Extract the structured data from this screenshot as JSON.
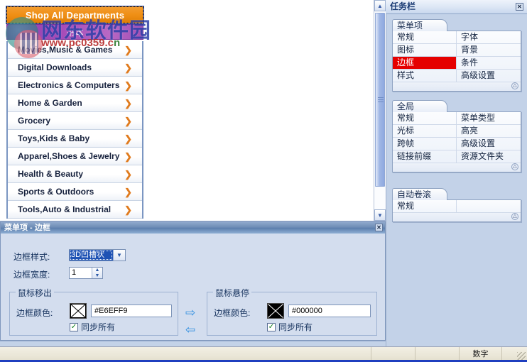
{
  "canvas": {
    "menu_widget": {
      "top_item_label": "Shop All Departments",
      "sub_item_label": "书本",
      "items": [
        {
          "label": "Movies,Music & Games",
          "chevron": "❯"
        },
        {
          "label": "Digital Downloads",
          "chevron": "❯"
        },
        {
          "label": "Electronics & Computers",
          "chevron": "❯"
        },
        {
          "label": "Home & Garden",
          "chevron": "❯"
        },
        {
          "label": "Grocery",
          "chevron": "❯"
        },
        {
          "label": "Toys,Kids & Baby",
          "chevron": "❯"
        },
        {
          "label": "Apparel,Shoes & Jewelry",
          "chevron": "❯"
        },
        {
          "label": "Health & Beauty",
          "chevron": "❯"
        },
        {
          "label": "Sports & Outdoors",
          "chevron": "❯"
        },
        {
          "label": "Tools,Auto & Industrial",
          "chevron": "❯"
        }
      ]
    },
    "watermark": {
      "chinese": "网东软件园",
      "url_red": "www.pc0359.c",
      "url_green": "n"
    },
    "scrollbar": {
      "up_arrow": "▲",
      "down_arrow": "▼"
    }
  },
  "property_dialog": {
    "title": "菜单项 - 边框",
    "close_label": "✕",
    "border_style": {
      "label": "边框样式:",
      "value": "3D凹槽状",
      "arrow": "▼"
    },
    "border_width": {
      "label": "边框宽度:",
      "value": "1",
      "up": "▲",
      "down": "▼"
    },
    "mouse_out": {
      "legend": "鼠标移出",
      "color_label": "边框颜色:",
      "color_value": "#E6EFF9",
      "sync_label": "同步所有",
      "sync_checked": "✓"
    },
    "mouse_over": {
      "legend": "鼠标悬停",
      "color_label": "边框颜色:",
      "color_value": "#000000",
      "sync_label": "同步所有",
      "sync_checked": "✓"
    },
    "copy_right_arrow": "⇨",
    "copy_left_arrow": "⇦"
  },
  "task_panel": {
    "title": "任务栏",
    "close_label": "✕",
    "groups": [
      {
        "tab": "菜单项",
        "rows": [
          [
            "常规",
            "字体"
          ],
          [
            "图标",
            "背景"
          ],
          [
            "边框",
            "条件"
          ],
          [
            "样式",
            "高级设置"
          ]
        ],
        "selected": {
          "row": 2,
          "col": 0
        },
        "collapse_icon": "△"
      },
      {
        "tab": "全局",
        "rows": [
          [
            "常规",
            "菜单类型"
          ],
          [
            "光标",
            "高亮"
          ],
          [
            "跨帧",
            "高级设置"
          ],
          [
            "链接前缀",
            "资源文件夹"
          ]
        ],
        "selected": null,
        "collapse_icon": "△"
      },
      {
        "tab": "自动卷滚",
        "rows": [
          [
            "常规",
            ""
          ]
        ],
        "selected": null,
        "collapse_icon": "△"
      }
    ]
  },
  "statusbar": {
    "cells": [
      "",
      "",
      "",
      "数字",
      ""
    ]
  },
  "colors": {
    "accent_blue": "#1e52b4",
    "selection_red": "#e50000",
    "menu_orange": "#ef8f15",
    "menu_purple": "#a64bb8",
    "panel_bg": "#c3d2e8"
  }
}
